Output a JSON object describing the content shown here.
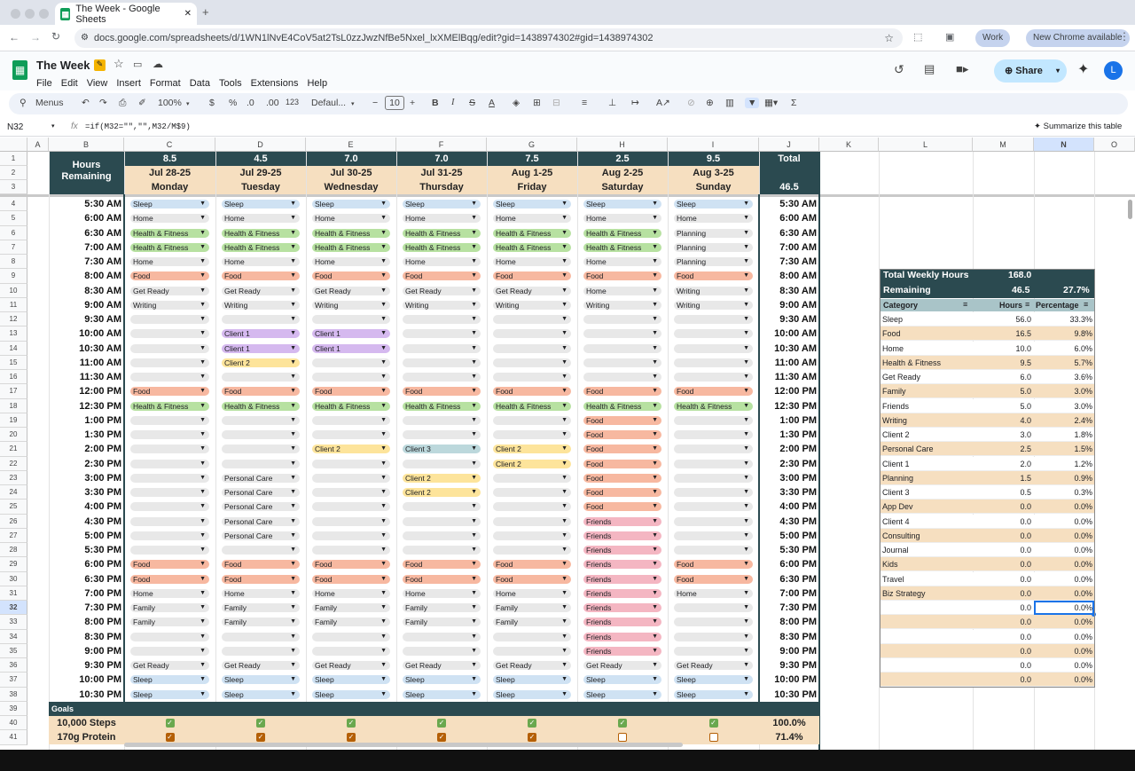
{
  "browser": {
    "tab_title": "The Week - Google Sheets",
    "url": "docs.google.com/spreadsheets/d/1WN1lNvE4CoV5at2TsL0zzJwzNfBe5Nxel_lxXMElBqg/edit?gid=1438974302#gid=1438974302",
    "profile": "Work",
    "update": "New Chrome available"
  },
  "doc": {
    "title": "The Week",
    "menus": [
      "File",
      "Edit",
      "View",
      "Insert",
      "Format",
      "Data",
      "Tools",
      "Extensions",
      "Help"
    ],
    "share": "Share",
    "avatar": "L"
  },
  "toolbar": {
    "menus": "Menus",
    "zoom": "100%",
    "currency": "$",
    "percent": "%",
    "dec_less": ".0",
    "dec_more": ".00",
    "format": "123",
    "font": "Defaul...",
    "font_size": "10",
    "sum": "Σ"
  },
  "formula": {
    "cell_ref": "N32",
    "fx": "fx",
    "text": "=if(M32=\"\",\"\",M32/M$9)",
    "summarize": "Summarize this table"
  },
  "columns": [
    "A",
    "B",
    "C",
    "D",
    "E",
    "F",
    "G",
    "H",
    "I",
    "J",
    "K",
    "L",
    "M",
    "N",
    "O"
  ],
  "header": {
    "remaining": "Hours Remaining",
    "total": "Total",
    "total_value": "46.5",
    "days": [
      {
        "hours": "8.5",
        "date": "Jul 28-25",
        "day": "Monday"
      },
      {
        "hours": "4.5",
        "date": "Jul 29-25",
        "day": "Tuesday"
      },
      {
        "hours": "7.0",
        "date": "Jul 30-25",
        "day": "Wednesday"
      },
      {
        "hours": "7.0",
        "date": "Jul 31-25",
        "day": "Thursday"
      },
      {
        "hours": "7.5",
        "date": "Aug 1-25",
        "day": "Friday"
      },
      {
        "hours": "2.5",
        "date": "Aug 2-25",
        "day": "Saturday"
      },
      {
        "hours": "9.5",
        "date": "Aug 3-25",
        "day": "Sunday"
      }
    ]
  },
  "category_colors": {
    "Sleep": "#cfe2f3",
    "Home": "#e8e8e8",
    "Health & Fitness": "#b7e1a1",
    "Food": "#f7b8a0",
    "Get Ready": "#e8e8e8",
    "Writing": "#e8e8e8",
    "Planning": "#e8e8e8",
    "Client 1": "#d5b9ef",
    "Client 2": "#fde49b",
    "Client 3": "#bcd8dc",
    "Personal Care": "#e8e8e8",
    "Family": "#e8e8e8",
    "Friends": "#f4b6c2",
    "": "#e8e8e8"
  },
  "schedule": [
    {
      "time": "5:30 AM",
      "cells": [
        "Sleep",
        "Sleep",
        "Sleep",
        "Sleep",
        "Sleep",
        "Sleep",
        "Sleep"
      ]
    },
    {
      "time": "6:00 AM",
      "cells": [
        "Home",
        "Home",
        "Home",
        "Home",
        "Home",
        "Home",
        "Home"
      ]
    },
    {
      "time": "6:30 AM",
      "cells": [
        "Health & Fitness",
        "Health & Fitness",
        "Health & Fitness",
        "Health & Fitness",
        "Health & Fitness",
        "Health & Fitness",
        "Planning"
      ]
    },
    {
      "time": "7:00 AM",
      "cells": [
        "Health & Fitness",
        "Health & Fitness",
        "Health & Fitness",
        "Health & Fitness",
        "Health & Fitness",
        "Health & Fitness",
        "Planning"
      ]
    },
    {
      "time": "7:30 AM",
      "cells": [
        "Home",
        "Home",
        "Home",
        "Home",
        "Home",
        "Home",
        "Planning"
      ]
    },
    {
      "time": "8:00 AM",
      "cells": [
        "Food",
        "Food",
        "Food",
        "Food",
        "Food",
        "Food",
        "Food"
      ]
    },
    {
      "time": "8:30 AM",
      "cells": [
        "Get Ready",
        "Get Ready",
        "Get Ready",
        "Get Ready",
        "Get Ready",
        "Home",
        "Writing"
      ]
    },
    {
      "time": "9:00 AM",
      "cells": [
        "Writing",
        "Writing",
        "Writing",
        "Writing",
        "Writing",
        "Writing",
        "Writing"
      ]
    },
    {
      "time": "9:30 AM",
      "cells": [
        "",
        "",
        "",
        "",
        "",
        "",
        ""
      ]
    },
    {
      "time": "10:00 AM",
      "cells": [
        "",
        "Client 1",
        "Client 1",
        "",
        "",
        "",
        ""
      ]
    },
    {
      "time": "10:30 AM",
      "cells": [
        "",
        "Client 1",
        "Client 1",
        "",
        "",
        "",
        ""
      ]
    },
    {
      "time": "11:00 AM",
      "cells": [
        "",
        "Client 2",
        "",
        "",
        "",
        "",
        ""
      ]
    },
    {
      "time": "11:30 AM",
      "cells": [
        "",
        "",
        "",
        "",
        "",
        "",
        ""
      ]
    },
    {
      "time": "12:00 PM",
      "cells": [
        "Food",
        "Food",
        "Food",
        "Food",
        "Food",
        "Food",
        "Food"
      ]
    },
    {
      "time": "12:30 PM",
      "cells": [
        "Health & Fitness",
        "Health & Fitness",
        "Health & Fitness",
        "Health & Fitness",
        "Health & Fitness",
        "Health & Fitness",
        "Health & Fitness"
      ]
    },
    {
      "time": "1:00 PM",
      "cells": [
        "",
        "",
        "",
        "",
        "",
        "Food",
        ""
      ]
    },
    {
      "time": "1:30 PM",
      "cells": [
        "",
        "",
        "",
        "",
        "",
        "Food",
        ""
      ]
    },
    {
      "time": "2:00 PM",
      "cells": [
        "",
        "",
        "Client 2",
        "Client 3",
        "Client 2",
        "Food",
        ""
      ]
    },
    {
      "time": "2:30 PM",
      "cells": [
        "",
        "",
        "",
        "",
        "Client 2",
        "Food",
        ""
      ]
    },
    {
      "time": "3:00 PM",
      "cells": [
        "",
        "Personal Care",
        "",
        "Client 2",
        "",
        "Food",
        ""
      ]
    },
    {
      "time": "3:30 PM",
      "cells": [
        "",
        "Personal Care",
        "",
        "Client 2",
        "",
        "Food",
        ""
      ]
    },
    {
      "time": "4:00 PM",
      "cells": [
        "",
        "Personal Care",
        "",
        "",
        "",
        "Food",
        ""
      ]
    },
    {
      "time": "4:30 PM",
      "cells": [
        "",
        "Personal Care",
        "",
        "",
        "",
        "Friends",
        ""
      ]
    },
    {
      "time": "5:00 PM",
      "cells": [
        "",
        "Personal Care",
        "",
        "",
        "",
        "Friends",
        ""
      ]
    },
    {
      "time": "5:30 PM",
      "cells": [
        "",
        "",
        "",
        "",
        "",
        "Friends",
        ""
      ]
    },
    {
      "time": "6:00 PM",
      "cells": [
        "Food",
        "Food",
        "Food",
        "Food",
        "Food",
        "Friends",
        "Food"
      ]
    },
    {
      "time": "6:30 PM",
      "cells": [
        "Food",
        "Food",
        "Food",
        "Food",
        "Food",
        "Friends",
        "Food"
      ]
    },
    {
      "time": "7:00 PM",
      "cells": [
        "Home",
        "Home",
        "Home",
        "Home",
        "Home",
        "Friends",
        "Home"
      ]
    },
    {
      "time": "7:30 PM",
      "cells": [
        "Family",
        "Family",
        "Family",
        "Family",
        "Family",
        "Friends",
        ""
      ]
    },
    {
      "time": "8:00 PM",
      "cells": [
        "Family",
        "Family",
        "Family",
        "Family",
        "Family",
        "Friends",
        ""
      ]
    },
    {
      "time": "8:30 PM",
      "cells": [
        "",
        "",
        "",
        "",
        "",
        "Friends",
        ""
      ]
    },
    {
      "time": "9:00 PM",
      "cells": [
        "",
        "",
        "",
        "",
        "",
        "Friends",
        ""
      ]
    },
    {
      "time": "9:30 PM",
      "cells": [
        "Get Ready",
        "Get Ready",
        "Get Ready",
        "Get Ready",
        "Get Ready",
        "Get Ready",
        "Get Ready"
      ]
    },
    {
      "time": "10:00 PM",
      "cells": [
        "Sleep",
        "Sleep",
        "Sleep",
        "Sleep",
        "Sleep",
        "Sleep",
        "Sleep"
      ]
    },
    {
      "time": "10:30 PM",
      "cells": [
        "Sleep",
        "Sleep",
        "Sleep",
        "Sleep",
        "Sleep",
        "Sleep",
        "Sleep"
      ]
    }
  ],
  "goals": {
    "label": "Goals",
    "rows": [
      {
        "name": "10,000 Steps",
        "checks": [
          true,
          true,
          true,
          true,
          true,
          true,
          true
        ],
        "pct": "100.0%"
      },
      {
        "name": "170g Protein",
        "checks": [
          true,
          true,
          true,
          true,
          true,
          false,
          false
        ],
        "pct": "71.4%"
      }
    ]
  },
  "summary": {
    "total_label": "Total Weekly Hours",
    "total_value": "168.0",
    "remaining_label": "Remaining",
    "remaining_value": "46.5",
    "remaining_pct": "27.7%",
    "headers": [
      "Category",
      "Hours",
      "Percentage"
    ],
    "rows": [
      [
        "Sleep",
        "56.0",
        "33.3%"
      ],
      [
        "Food",
        "16.5",
        "9.8%"
      ],
      [
        "Home",
        "10.0",
        "6.0%"
      ],
      [
        "Health & Fitness",
        "9.5",
        "5.7%"
      ],
      [
        "Get Ready",
        "6.0",
        "3.6%"
      ],
      [
        "Family",
        "5.0",
        "3.0%"
      ],
      [
        "Friends",
        "5.0",
        "3.0%"
      ],
      [
        "Writing",
        "4.0",
        "2.4%"
      ],
      [
        "Client 2",
        "3.0",
        "1.8%"
      ],
      [
        "Personal Care",
        "2.5",
        "1.5%"
      ],
      [
        "Client 1",
        "2.0",
        "1.2%"
      ],
      [
        "Planning",
        "1.5",
        "0.9%"
      ],
      [
        "Client 3",
        "0.5",
        "0.3%"
      ],
      [
        "App Dev",
        "0.0",
        "0.0%"
      ],
      [
        "Client 4",
        "0.0",
        "0.0%"
      ],
      [
        "Consulting",
        "0.0",
        "0.0%"
      ],
      [
        "Journal",
        "0.0",
        "0.0%"
      ],
      [
        "Kids",
        "0.0",
        "0.0%"
      ],
      [
        "Travel",
        "0.0",
        "0.0%"
      ],
      [
        "Biz Strategy",
        "0.0",
        "0.0%"
      ],
      [
        "",
        "0.0",
        "0.0%"
      ],
      [
        "",
        "0.0",
        "0.0%"
      ],
      [
        "",
        "0.0",
        "0.0%"
      ],
      [
        "",
        "0.0",
        "0.0%"
      ],
      [
        "",
        "0.0",
        "0.0%"
      ],
      [
        "",
        "0.0",
        "0.0%"
      ]
    ]
  }
}
